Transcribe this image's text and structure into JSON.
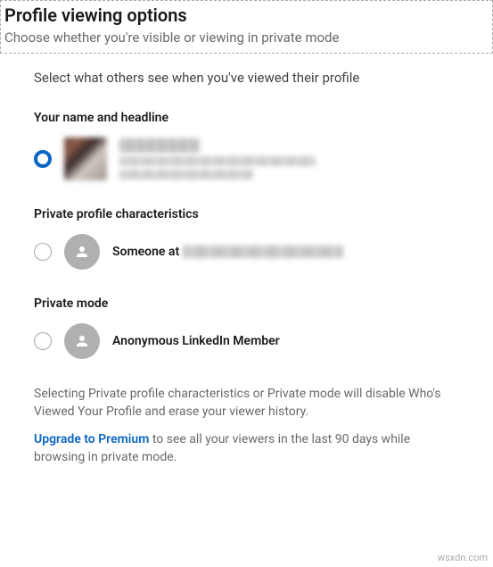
{
  "header": {
    "title": "Profile viewing options",
    "subtitle": "Choose whether you're visible or viewing in private mode"
  },
  "instruction": "Select what others see when you've viewed their profile",
  "options": {
    "full": {
      "label": "Your name and headline"
    },
    "semi": {
      "label": "Private profile characteristics",
      "prefix": "Someone at"
    },
    "anon": {
      "label": "Private mode",
      "text": "Anonymous LinkedIn Member"
    }
  },
  "footnote": "Selecting Private profile characteristics or Private mode will disable Who's Viewed Your Profile and erase your viewer history.",
  "premium": {
    "link": "Upgrade to Premium",
    "rest": " to see all your viewers in the last 90 days while browsing in private mode."
  },
  "watermark": "wsxdn.com"
}
